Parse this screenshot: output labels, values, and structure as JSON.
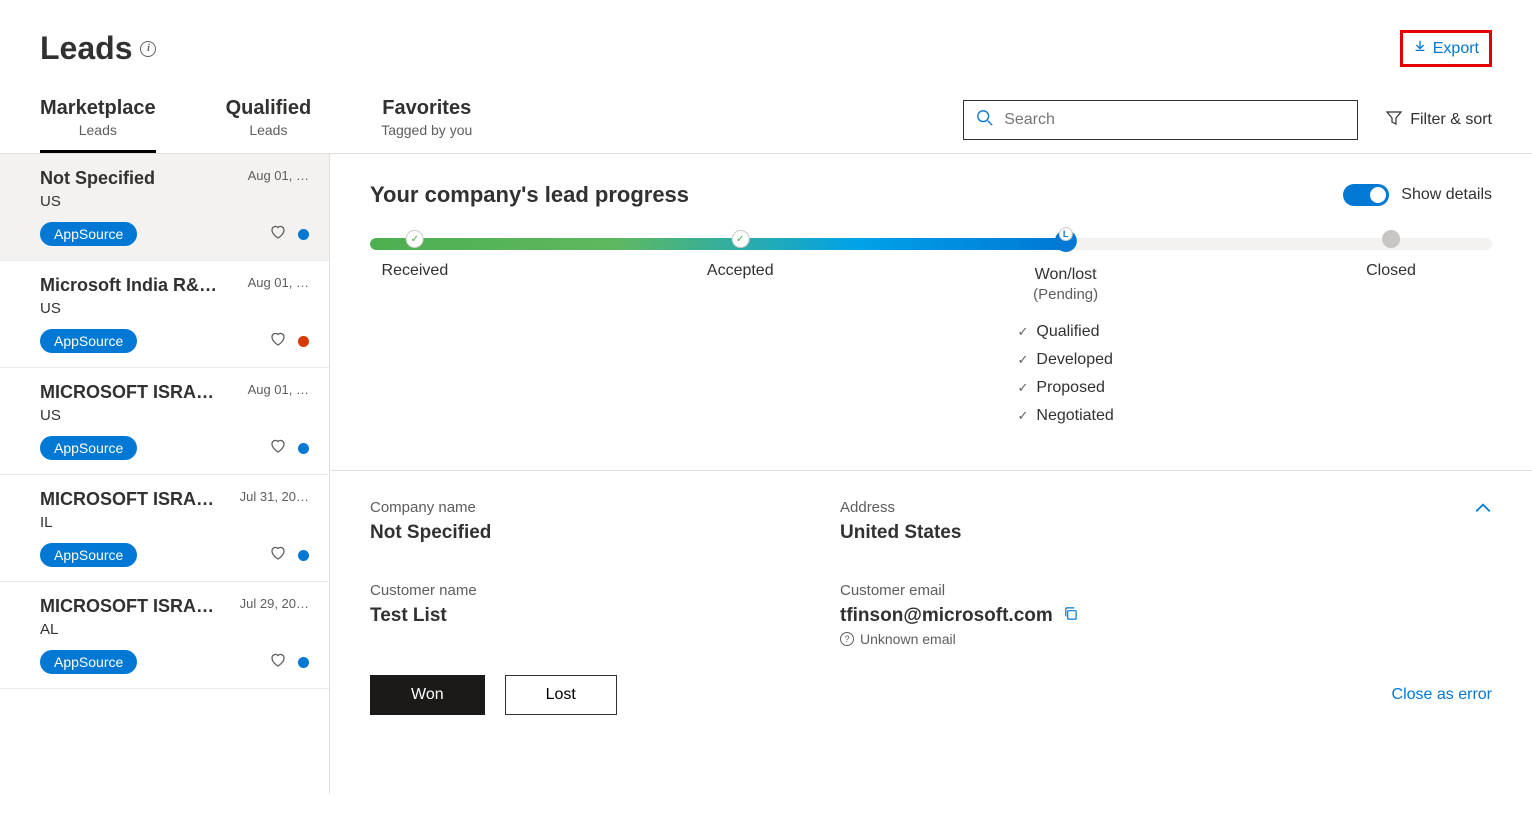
{
  "header": {
    "title": "Leads",
    "export_label": "Export"
  },
  "tabs": [
    {
      "label": "Marketplace",
      "sublabel": "Leads",
      "active": true
    },
    {
      "label": "Qualified",
      "sublabel": "Leads",
      "active": false
    },
    {
      "label": "Favorites",
      "sublabel": "Tagged by you",
      "active": false
    }
  ],
  "search": {
    "placeholder": "Search"
  },
  "filter_sort_label": "Filter & sort",
  "leads": [
    {
      "title": "Not Specified",
      "region": "US",
      "date": "Aug 01, …",
      "tag": "AppSource",
      "dot": "blue",
      "selected": true
    },
    {
      "title": "Microsoft India R&…",
      "region": "US",
      "date": "Aug 01, …",
      "tag": "AppSource",
      "dot": "orange",
      "selected": false
    },
    {
      "title": "MICROSOFT ISRAE…",
      "region": "US",
      "date": "Aug 01, …",
      "tag": "AppSource",
      "dot": "blue",
      "selected": false
    },
    {
      "title": "MICROSOFT ISRAE…",
      "region": "IL",
      "date": "Jul 31, 20…",
      "tag": "AppSource",
      "dot": "blue",
      "selected": false
    },
    {
      "title": "MICROSOFT ISRAE…",
      "region": "AL",
      "date": "Jul 29, 20…",
      "tag": "AppSource",
      "dot": "blue",
      "selected": false
    }
  ],
  "progress": {
    "title": "Your company's lead progress",
    "show_details_label": "Show details",
    "fill_percent": 62,
    "stages": [
      {
        "label": "Received",
        "pos": 4,
        "state": "done"
      },
      {
        "label": "Accepted",
        "pos": 33,
        "state": "done"
      },
      {
        "label": "Won/lost",
        "sublabel": "(Pending)",
        "pos": 62,
        "state": "current",
        "checks": [
          "Qualified",
          "Developed",
          "Proposed",
          "Negotiated"
        ]
      },
      {
        "label": "Closed",
        "pos": 91,
        "state": "future"
      }
    ]
  },
  "info": {
    "company_name_label": "Company name",
    "company_name": "Not Specified",
    "address_label": "Address",
    "address": "United States",
    "customer_name_label": "Customer name",
    "customer_name": "Test List",
    "customer_email_label": "Customer email",
    "customer_email": "tfinson@microsoft.com",
    "email_status": "Unknown email"
  },
  "actions": {
    "won": "Won",
    "lost": "Lost",
    "close_as_error": "Close as error"
  }
}
